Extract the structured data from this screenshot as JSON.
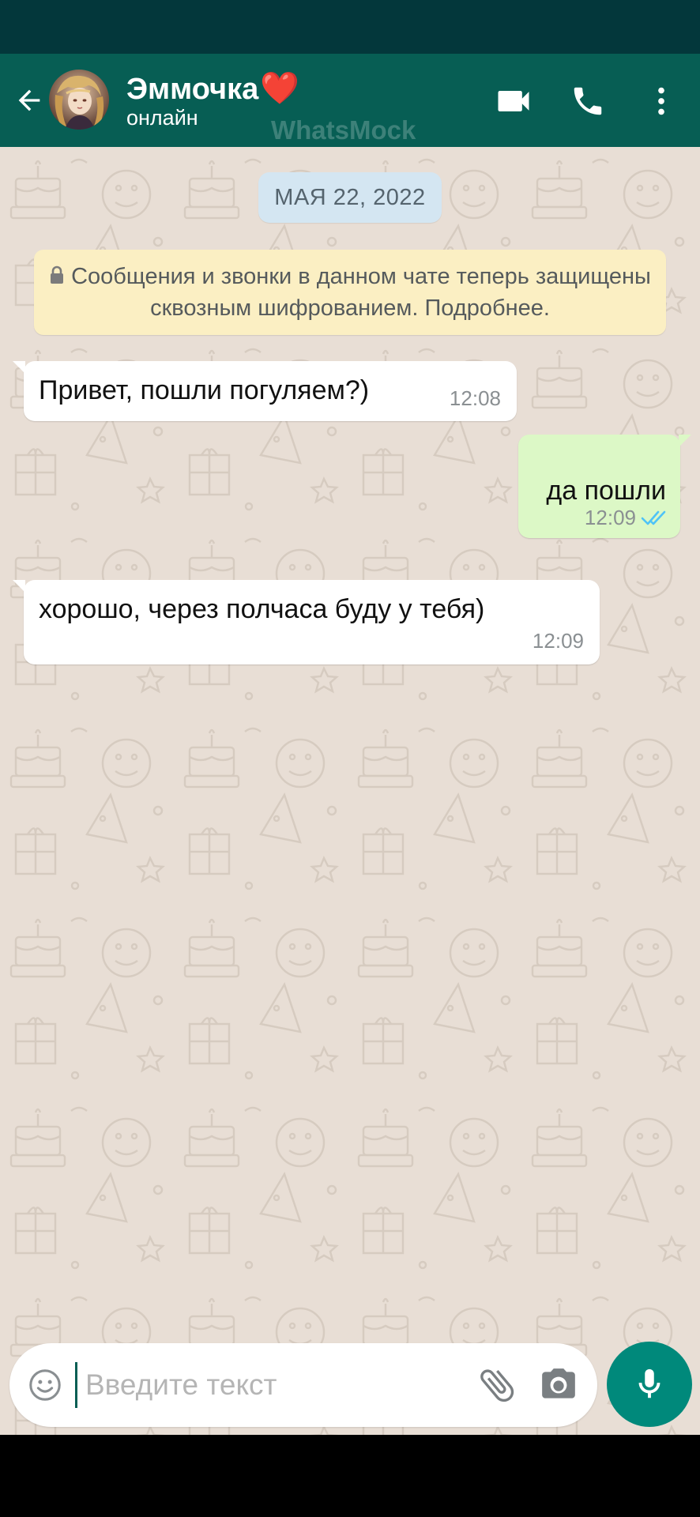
{
  "header": {
    "contact_name": "Эммочка",
    "contact_emoji": "❤️",
    "status": "онлайн",
    "watermark": "WhatsMock",
    "icons": [
      "back-arrow-icon",
      "video-call-icon",
      "phone-icon",
      "more-vert-icon"
    ]
  },
  "chat": {
    "date_chip": "МАЯ 22, 2022",
    "encryption_notice": "Сообщения и звонки в данном чате теперь защищены сквозным шифрованием. Подробнее.",
    "messages": [
      {
        "direction": "incoming",
        "text": "Привет, пошли погуляем?)",
        "time": "12:08"
      },
      {
        "direction": "outgoing",
        "text": "да пошли",
        "time": "12:09",
        "status": "read"
      },
      {
        "direction": "incoming",
        "text": "хорошо, через полчаса буду у тебя)",
        "time": "12:09"
      }
    ]
  },
  "composer": {
    "placeholder": "Введите текст",
    "icons": [
      "emoji-icon",
      "attach-icon",
      "camera-icon",
      "mic-icon"
    ]
  },
  "colors": {
    "header": "#075e54",
    "status_bar": "#03373b",
    "outgoing_bubble": "#dcf8c6",
    "incoming_bubble": "#ffffff",
    "mic_button": "#00897b",
    "read_ticks": "#4fc3f7",
    "wallpaper": "#e8ded5"
  }
}
